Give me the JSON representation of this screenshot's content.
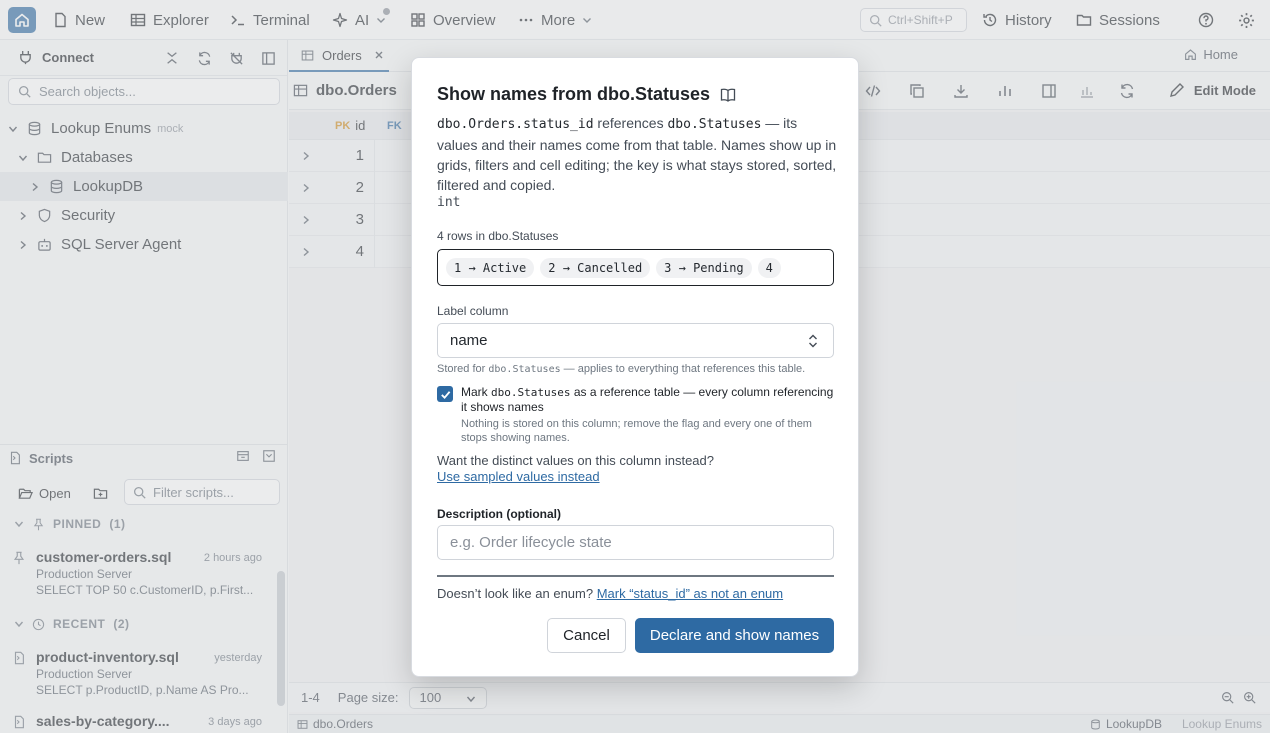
{
  "topbar": {
    "new_label": "New",
    "explorer_label": "Explorer",
    "terminal_label": "Terminal",
    "ai_label": "AI",
    "overview_label": "Overview",
    "more_label": "More",
    "search_shortcut": "Ctrl+Shift+P",
    "history_label": "History",
    "sessions_label": "Sessions"
  },
  "sidebar": {
    "connect_label": "Connect",
    "search_placeholder": "Search objects...",
    "tree": [
      {
        "label": "Lookup Enums",
        "badge": "mock"
      },
      {
        "label": "Databases"
      },
      {
        "label": "LookupDB"
      },
      {
        "label": "Security"
      },
      {
        "label": "SQL Server Agent"
      }
    ]
  },
  "scripts": {
    "title": "Scripts",
    "open_label": "Open",
    "filter_placeholder": "Filter scripts...",
    "pinned_label": "PINNED",
    "pinned_count": "(1)",
    "recent_label": "RECENT",
    "recent_count": "(2)",
    "items": [
      {
        "name": "customer-orders.sql",
        "time": "2 hours ago",
        "server": "Production Server",
        "sql": "SELECT TOP 50 c.CustomerID, p.First..."
      },
      {
        "name": "product-inventory.sql",
        "time": "yesterday",
        "server": "Production Server",
        "sql": "SELECT p.ProductID, p.Name AS Pro..."
      },
      {
        "name": "sales-by-category....",
        "time": "3 days ago"
      }
    ]
  },
  "main": {
    "tab_label": "Orders",
    "home_label": "Home",
    "table_title": "dbo.Orders",
    "edit_mode_label": "Edit Mode",
    "col_pk_tag": "PK",
    "col_id": "id",
    "col_fk_tag": "FK",
    "rows": [
      "1",
      "2",
      "3",
      "4"
    ],
    "range_label": "1-4",
    "page_size_label": "Page size:",
    "page_size_value": "100",
    "status_table": "dbo.Orders",
    "status_db": "LookupDB",
    "status_conn": "Lookup Enums"
  },
  "modal": {
    "title": "Show names from dbo.Statuses",
    "desc_col": "dbo.Orders.status_id",
    "desc_ref_word": " references ",
    "desc_table": "dbo.Statuses",
    "desc_rest": " — its values and their names come from that table. Names show up in grids, filters and cell editing; the key is what stays stored, sorted, filtered and copied.",
    "type": "int",
    "rows_label": "4 rows in dbo.Statuses",
    "chips": [
      "1 → Active",
      "2 → Cancelled",
      "3 → Pending",
      "4"
    ],
    "label_column_label": "Label column",
    "label_column_value": "name",
    "stored_hint_pre": "Stored for ",
    "stored_hint_table": "dbo.Statuses",
    "stored_hint_post": " — applies to everything that references this table.",
    "ref_pre": "Mark ",
    "ref_table": "dbo.Statuses",
    "ref_post": " as a reference table — every column referencing it shows names",
    "ref_sub": "Nothing is stored on this column; remove the flag and every one of them stops showing names.",
    "question": "Want the distinct values on this column instead?",
    "sampled_link": "Use sampled values instead",
    "description_label": "Description (optional)",
    "description_placeholder": "e.g. Order lifecycle state",
    "not_enum_question": "Doesn’t look like an enum? ",
    "not_enum_link": "Mark “status_id” as not an enum",
    "cancel_label": "Cancel",
    "primary_label": "Declare and show names"
  },
  "colors": {
    "accent": "#2e6aa3",
    "pk": "#d08a1a"
  }
}
